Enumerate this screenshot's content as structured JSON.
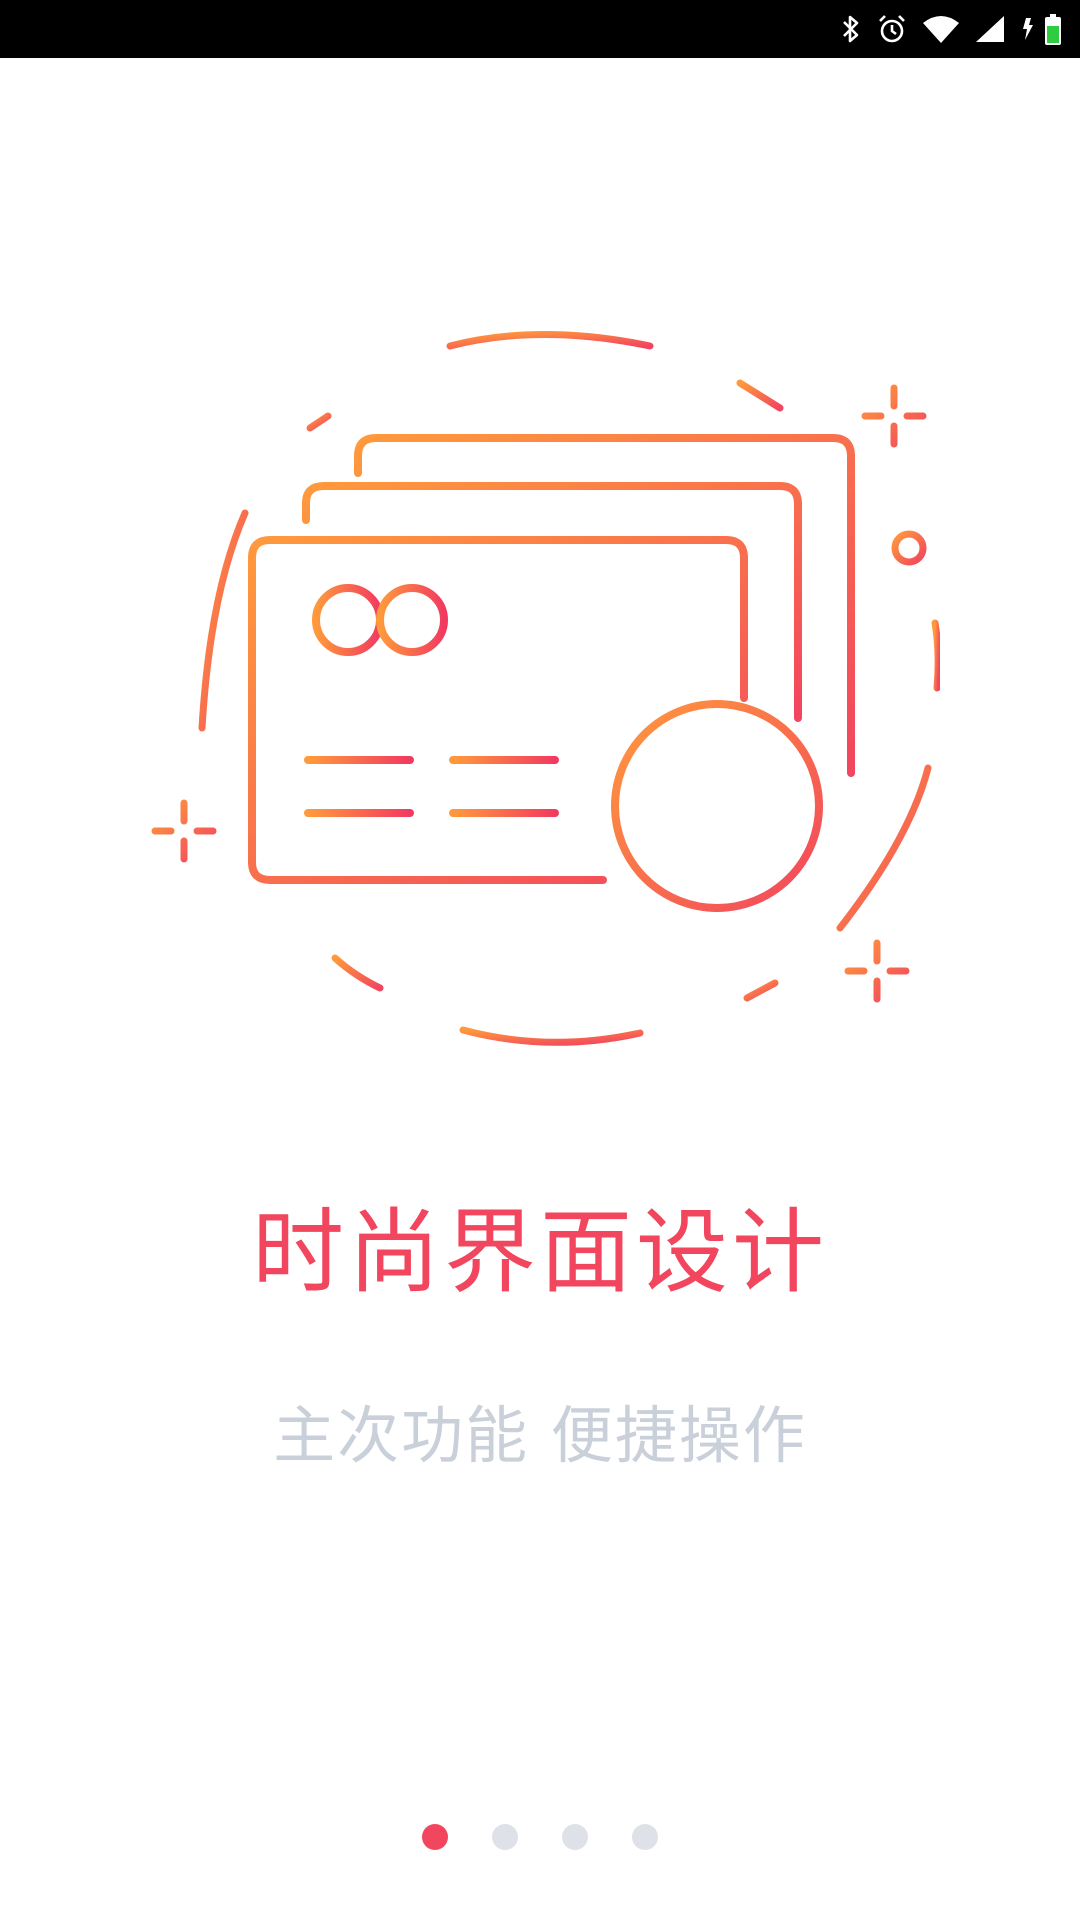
{
  "status_bar": {
    "icons": [
      "bluetooth-icon",
      "alarm-icon",
      "wifi-icon",
      "cell-signal-icon",
      "battery-icon"
    ]
  },
  "onboarding": {
    "illustration": "credit-cards-add-icon",
    "title": "时尚界面设计",
    "subtitle": "主次功能 便捷操作"
  },
  "pager": {
    "total": 4,
    "active_index": 0
  },
  "colors": {
    "accent": "#f2455e",
    "gradient_start": "#ff9a3c",
    "gradient_end": "#f23a60",
    "subtitle": "#c9d0da",
    "dot_inactive": "#dfe1e8"
  }
}
